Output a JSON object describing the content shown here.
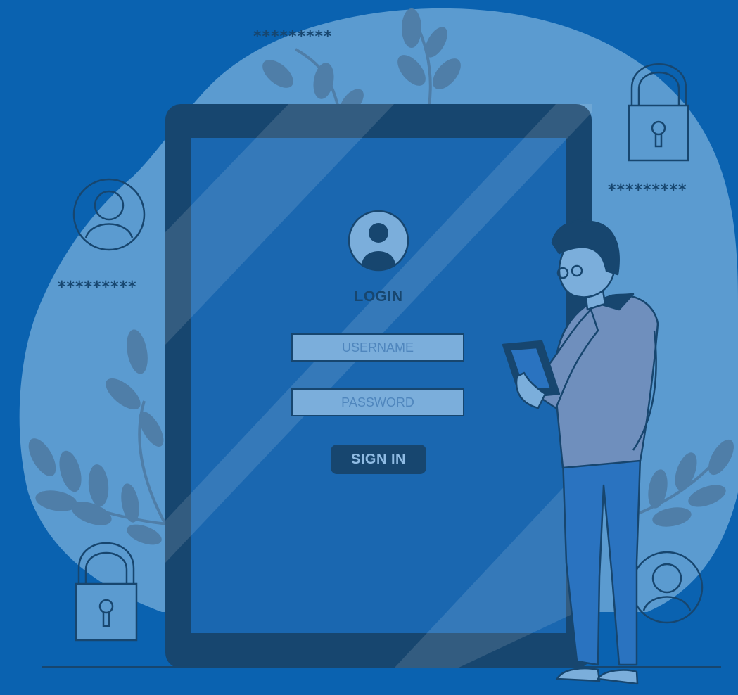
{
  "colors": {
    "background": "#0a62b0",
    "blob": "#5b9bd0",
    "device_frame": "#17466f",
    "screen": "#1a67b0",
    "field_fill": "#7baedb",
    "button": "#17466f",
    "leaf": "#4f7ea8"
  },
  "decor": {
    "password_mask_top": "*********",
    "password_mask_right": "*********",
    "password_mask_left": "*********",
    "icons": [
      "user-avatar-icon",
      "padlock-icon",
      "leaf-icon",
      "person-with-tablet-illustration"
    ]
  },
  "login": {
    "title": "LOGIN",
    "username_placeholder": "USERNAME",
    "password_placeholder": "PASSWORD",
    "signin_label": "SIGN IN"
  }
}
